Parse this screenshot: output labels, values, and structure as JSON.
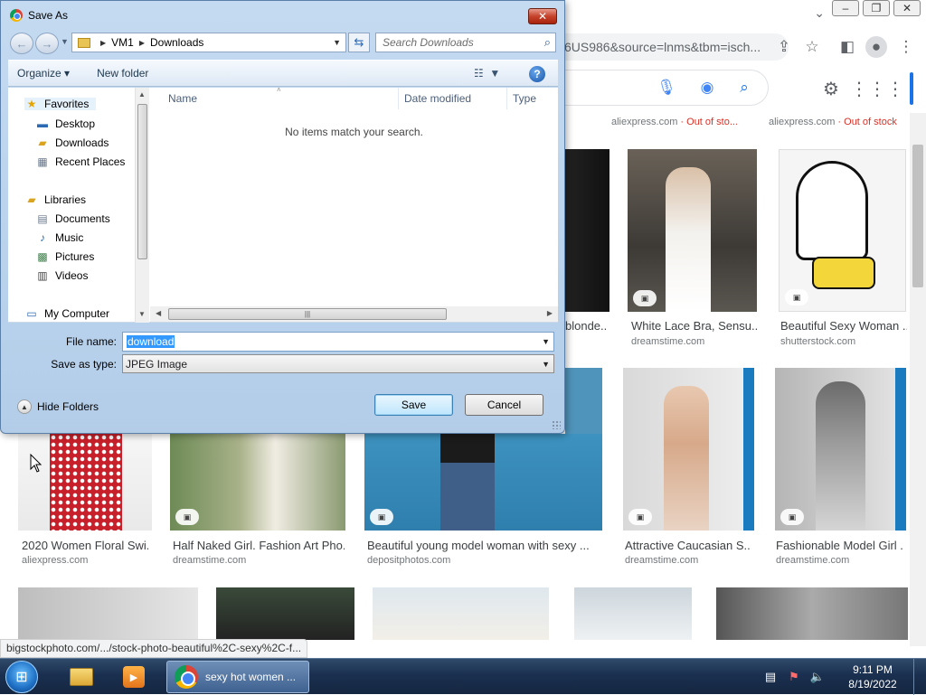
{
  "browser": {
    "address_text": "6US986&source=lnms&tbm=isch...",
    "window_controls": [
      "–",
      "❐",
      "✕"
    ],
    "status_url": "bigstockphoto.com/.../stock-photo-beautiful%2C-sexy%2C-f...",
    "results_row0": [
      {
        "source": "aliexpress.com",
        "suffix": " · Out of sto..."
      },
      {
        "source": "aliexpress.com",
        "suffix": " · Out of stock"
      }
    ],
    "results_row1": [
      {
        "title": "blonde..."
      },
      {
        "title": "White Lace Bra, Sensu...",
        "source": "dreamstime.com"
      },
      {
        "title": "Beautiful Sexy Woman ...",
        "source": "shutterstock.com"
      }
    ],
    "results_row2": [
      {
        "title": "2020 Women Floral Swi...",
        "source": "aliexpress.com"
      },
      {
        "title": "Half Naked Girl. Fashion Art Pho...",
        "source": "dreamstime.com"
      },
      {
        "title": "Beautiful young model woman with sexy ...",
        "source": "depositphotos.com"
      },
      {
        "title": "Attractive Caucasian S...",
        "source": "dreamstime.com"
      },
      {
        "title": "Fashionable Model Girl ...",
        "source": "dreamstime.com"
      }
    ],
    "colors": {
      "out_of_stock": "#d93025",
      "accent": "#1a73e8"
    }
  },
  "dialog": {
    "title": "Save As",
    "close_label": "✕",
    "breadcrumb": [
      "VM1",
      "Downloads"
    ],
    "search_placeholder": "Search Downloads",
    "organize_label": "Organize ▾",
    "new_folder_label": "New folder",
    "nav_items": {
      "favorites": "Favorites",
      "desktop": "Desktop",
      "downloads": "Downloads",
      "recent": "Recent Places",
      "libraries": "Libraries",
      "documents": "Documents",
      "music": "Music",
      "pictures": "Pictures",
      "videos": "Videos",
      "my_computer": "My Computer"
    },
    "columns": {
      "name": "Name",
      "date": "Date modified",
      "type": "Type"
    },
    "empty_message": "No items match your search.",
    "file_name_label": "File name:",
    "file_name_value": "download",
    "save_type_label": "Save as type:",
    "save_type_value": "JPEG Image",
    "hide_folders_label": "Hide Folders",
    "save_label": "Save",
    "cancel_label": "Cancel"
  },
  "taskbar": {
    "chrome_task_label": "sexy hot women ...",
    "time": "9:11 PM",
    "date": "8/19/2022"
  }
}
